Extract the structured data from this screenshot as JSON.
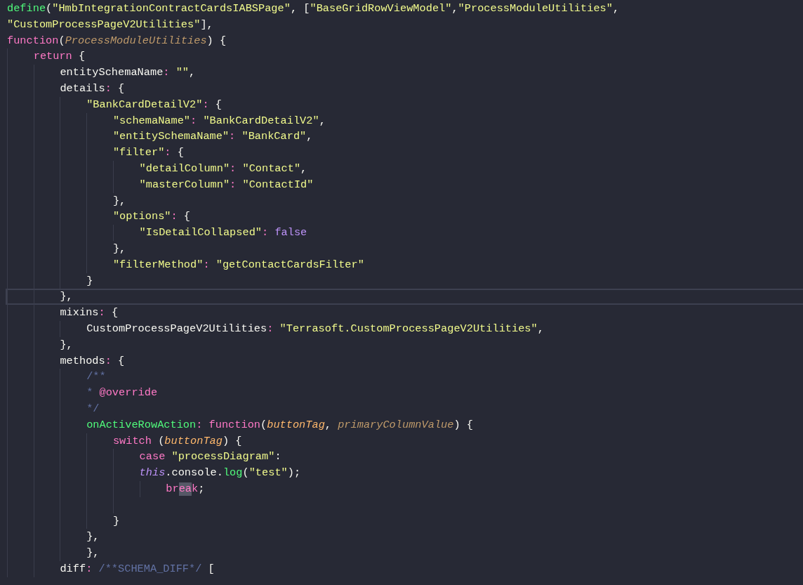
{
  "editor": {
    "lines": [
      {
        "current": false,
        "tokens": [
          {
            "text": "define",
            "kind": "call"
          },
          {
            "text": "(",
            "kind": "plain"
          },
          {
            "text": "\"HmbIntegrationContractCardsIABSPage\"",
            "kind": "string"
          },
          {
            "text": ", [",
            "kind": "plain"
          },
          {
            "text": "\"BaseGridRowViewModel\"",
            "kind": "string"
          },
          {
            "text": ",",
            "kind": "plain"
          },
          {
            "text": "\"ProcessModuleUtilities\"",
            "kind": "string"
          },
          {
            "text": ",",
            "kind": "plain"
          }
        ]
      },
      {
        "current": false,
        "tokens": [
          {
            "text": "\"CustomProcessPageV2Utilities\"",
            "kind": "string"
          },
          {
            "text": "],",
            "kind": "plain"
          }
        ]
      },
      {
        "current": false,
        "tokens": [
          {
            "text": "function",
            "kind": "keyword"
          },
          {
            "text": "(",
            "kind": "plain"
          },
          {
            "text": "ProcessModuleUtilities",
            "kind": "param_unused"
          },
          {
            "text": ") {",
            "kind": "plain"
          }
        ]
      },
      {
        "current": false,
        "tokens": [
          {
            "text": "    return",
            "kind": "keyword"
          },
          {
            "text": " {",
            "kind": "plain"
          }
        ]
      },
      {
        "current": false,
        "tokens": [
          {
            "text": "        entitySchemaName",
            "kind": "plain"
          },
          {
            "text": ": ",
            "kind": "operator"
          },
          {
            "text": "\"\"",
            "kind": "string"
          },
          {
            "text": ",",
            "kind": "plain"
          }
        ]
      },
      {
        "current": false,
        "tokens": [
          {
            "text": "        details",
            "kind": "plain"
          },
          {
            "text": ": ",
            "kind": "operator"
          },
          {
            "text": "{",
            "kind": "plain"
          }
        ]
      },
      {
        "current": false,
        "tokens": [
          {
            "text": "            \"BankCardDetailV2\"",
            "kind": "string"
          },
          {
            "text": ": ",
            "kind": "operator"
          },
          {
            "text": "{",
            "kind": "plain"
          }
        ]
      },
      {
        "current": false,
        "tokens": [
          {
            "text": "                \"schemaName\"",
            "kind": "string"
          },
          {
            "text": ": ",
            "kind": "operator"
          },
          {
            "text": "\"BankCardDetailV2\"",
            "kind": "string"
          },
          {
            "text": ",",
            "kind": "plain"
          }
        ]
      },
      {
        "current": false,
        "tokens": [
          {
            "text": "                \"entitySchemaName\"",
            "kind": "string"
          },
          {
            "text": ": ",
            "kind": "operator"
          },
          {
            "text": "\"BankCard\"",
            "kind": "string"
          },
          {
            "text": ",",
            "kind": "plain"
          }
        ]
      },
      {
        "current": false,
        "tokens": [
          {
            "text": "                \"filter\"",
            "kind": "string"
          },
          {
            "text": ": ",
            "kind": "operator"
          },
          {
            "text": "{",
            "kind": "plain"
          }
        ]
      },
      {
        "current": false,
        "tokens": [
          {
            "text": "                    \"detailColumn\"",
            "kind": "string"
          },
          {
            "text": ": ",
            "kind": "operator"
          },
          {
            "text": "\"Contact\"",
            "kind": "string"
          },
          {
            "text": ",",
            "kind": "plain"
          }
        ]
      },
      {
        "current": false,
        "tokens": [
          {
            "text": "                    \"masterColumn\"",
            "kind": "string"
          },
          {
            "text": ": ",
            "kind": "operator"
          },
          {
            "text": "\"ContactId\"",
            "kind": "string"
          }
        ]
      },
      {
        "current": false,
        "tokens": [
          {
            "text": "                },",
            "kind": "plain"
          }
        ]
      },
      {
        "current": false,
        "tokens": [
          {
            "text": "                \"options\"",
            "kind": "string"
          },
          {
            "text": ": ",
            "kind": "operator"
          },
          {
            "text": "{",
            "kind": "plain"
          }
        ]
      },
      {
        "current": false,
        "tokens": [
          {
            "text": "                    \"IsDetailCollapsed\"",
            "kind": "string"
          },
          {
            "text": ": ",
            "kind": "operator"
          },
          {
            "text": "false",
            "kind": "constant"
          }
        ]
      },
      {
        "current": false,
        "tokens": [
          {
            "text": "                },",
            "kind": "plain"
          }
        ]
      },
      {
        "current": false,
        "tokens": [
          {
            "text": "                \"filterMethod\"",
            "kind": "string"
          },
          {
            "text": ": ",
            "kind": "operator"
          },
          {
            "text": "\"getContactCardsFilter\"",
            "kind": "string"
          }
        ]
      },
      {
        "current": false,
        "tokens": [
          {
            "text": "            }",
            "kind": "plain"
          }
        ]
      },
      {
        "current": true,
        "tokens": [
          {
            "text": "        },",
            "kind": "plain"
          }
        ]
      },
      {
        "current": false,
        "tokens": [
          {
            "text": "        mixins",
            "kind": "plain"
          },
          {
            "text": ": ",
            "kind": "operator"
          },
          {
            "text": "{",
            "kind": "plain"
          }
        ]
      },
      {
        "current": false,
        "tokens": [
          {
            "text": "            CustomProcessPageV2Utilities",
            "kind": "plain"
          },
          {
            "text": ": ",
            "kind": "operator"
          },
          {
            "text": "\"Terrasoft.CustomProcessPageV2Utilities\"",
            "kind": "string"
          },
          {
            "text": ",",
            "kind": "plain"
          }
        ]
      },
      {
        "current": false,
        "tokens": [
          {
            "text": "        },",
            "kind": "plain"
          }
        ]
      },
      {
        "current": false,
        "tokens": [
          {
            "text": "        methods",
            "kind": "plain"
          },
          {
            "text": ": ",
            "kind": "operator"
          },
          {
            "text": "{",
            "kind": "plain"
          }
        ]
      },
      {
        "current": false,
        "tokens": [
          {
            "text": "            /**",
            "kind": "comment"
          }
        ]
      },
      {
        "current": false,
        "tokens": [
          {
            "text": "            * ",
            "kind": "comment"
          },
          {
            "text": "@override",
            "kind": "doc_tag"
          }
        ]
      },
      {
        "current": false,
        "tokens": [
          {
            "text": "            */",
            "kind": "comment"
          }
        ]
      },
      {
        "current": false,
        "tokens": [
          {
            "text": "            onActiveRowAction",
            "kind": "call"
          },
          {
            "text": ": ",
            "kind": "operator"
          },
          {
            "text": "function",
            "kind": "keyword"
          },
          {
            "text": "(",
            "kind": "plain"
          },
          {
            "text": "buttonTag",
            "kind": "param"
          },
          {
            "text": ", ",
            "kind": "plain"
          },
          {
            "text": "primaryColumnValue",
            "kind": "param_unused"
          },
          {
            "text": ") {",
            "kind": "plain"
          }
        ]
      },
      {
        "current": false,
        "tokens": [
          {
            "text": "                switch",
            "kind": "keyword"
          },
          {
            "text": " (",
            "kind": "plain"
          },
          {
            "text": "buttonTag",
            "kind": "param"
          },
          {
            "text": ") {",
            "kind": "plain"
          }
        ]
      },
      {
        "current": false,
        "tokens": [
          {
            "text": "                    case ",
            "kind": "keyword"
          },
          {
            "text": "\"processDiagram\"",
            "kind": "string"
          },
          {
            "text": ":",
            "kind": "plain"
          }
        ]
      },
      {
        "current": false,
        "tokens": [
          {
            "text": "                    this",
            "kind": "this"
          },
          {
            "text": ".console.",
            "kind": "plain"
          },
          {
            "text": "log",
            "kind": "call"
          },
          {
            "text": "(",
            "kind": "plain"
          },
          {
            "text": "\"test\"",
            "kind": "string"
          },
          {
            "text": ");",
            "kind": "plain"
          }
        ]
      },
      {
        "current": false,
        "tokens": [
          {
            "text": "                        br",
            "kind": "keyword"
          },
          {
            "text": "ea",
            "kind": "keyword_match"
          },
          {
            "text": "k",
            "kind": "keyword"
          },
          {
            "text": ";",
            "kind": "plain"
          }
        ]
      },
      {
        "current": false
      },
      {
        "current": false,
        "tokens": [
          {
            "text": "                }",
            "kind": "plain"
          }
        ]
      },
      {
        "current": false,
        "tokens": [
          {
            "text": "            },",
            "kind": "plain"
          }
        ]
      },
      {
        "current": false,
        "tokens": [
          {
            "text": "            },",
            "kind": "plain"
          }
        ]
      },
      {
        "current": false,
        "tokens": [
          {
            "text": "        diff",
            "kind": "plain"
          },
          {
            "text": ": ",
            "kind": "operator"
          },
          {
            "text": "/**SCHEMA_DIFF*/",
            "kind": "comment"
          },
          {
            "text": " [",
            "kind": "plain"
          }
        ]
      }
    ]
  }
}
